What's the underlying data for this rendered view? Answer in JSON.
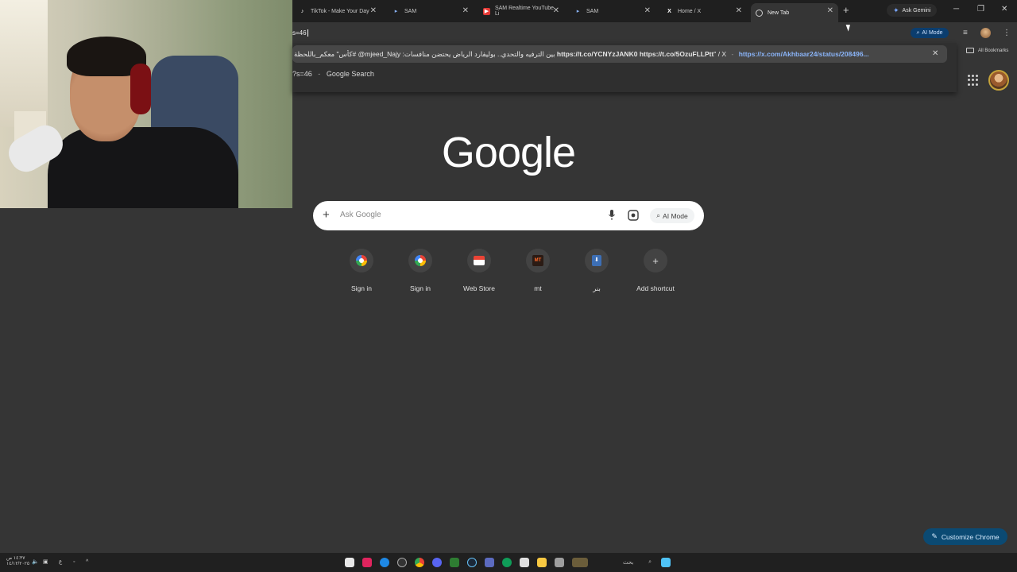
{
  "browser": {
    "tabs": [
      {
        "title": "TikTok - Make Your Day",
        "icon": "tiktok-icon",
        "active": false
      },
      {
        "title": "SAM",
        "icon": "sam-icon",
        "active": false
      },
      {
        "title": "SAM Realtime YouTube Li",
        "icon": "youtube-icon",
        "active": false
      },
      {
        "title": "SAM",
        "icon": "sam-icon",
        "active": false
      },
      {
        "title": "Home / X",
        "icon": "x-icon",
        "active": false
      },
      {
        "title": "New Tab",
        "icon": "chrome-icon",
        "active": true
      }
    ],
    "ask_gemini": "Ask Gemini",
    "omnibox_text": "s=46",
    "ai_mode_chip": "AI Mode",
    "window_controls": [
      "minimize",
      "restore",
      "close"
    ]
  },
  "suggestions": {
    "first": {
      "prefix_rtl": "كأس\" ",
      "arabic_text": "معكم_باللحظة# @mjeed_Najy :بين الترفيه والتحدي.. بوليفارد الرياض يحتضن منافسات",
      "link1": "https://t.co/YCNYzJANK0",
      "link2": "https://t.co/5OzuFLLPtt",
      "suffix": "\" / X",
      "separator": "-",
      "url": "https://x.com/Akhbaar24/status/208496..."
    },
    "second": {
      "query": "?s=46",
      "separator": "-",
      "type": "Google Search"
    }
  },
  "side": {
    "bookmarks_label": "All Bookmarks"
  },
  "ntp": {
    "logo": "Google",
    "search_placeholder": "Ask Google",
    "ai_mode": "AI Mode",
    "shortcuts": [
      {
        "label": "Sign in",
        "icon": "google-icon"
      },
      {
        "label": "Sign in",
        "icon": "google-icon"
      },
      {
        "label": "Web Store",
        "icon": "web-store-icon"
      },
      {
        "label": "mt",
        "icon": "mt-icon"
      },
      {
        "label": "بنر",
        "icon": "bank-icon"
      },
      {
        "label": "Add shortcut",
        "icon": "plus-icon"
      }
    ],
    "customize": "Customize Chrome"
  },
  "taskbar": {
    "time": "١٤:٣٧ ص",
    "date": "١٤/١٢/٢٠٢٥",
    "search_label": "بحث"
  }
}
